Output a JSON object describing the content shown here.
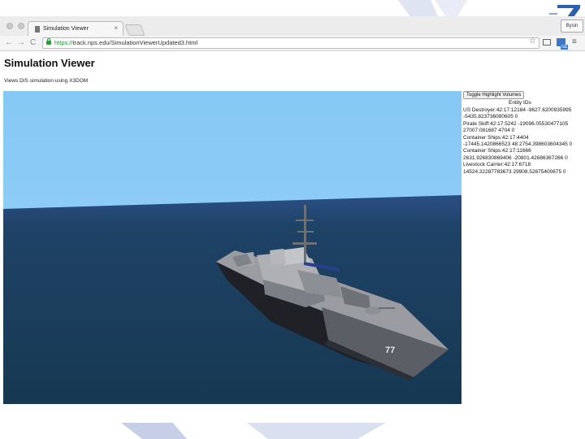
{
  "browser": {
    "tab_title": "Simulation Viewer",
    "tab_close": "×",
    "profile_label": "Bysin",
    "address_scheme": "https://",
    "address_rest": "track.nps.edu/SimulationViewerUpdated3.html",
    "nav": {
      "back": "←",
      "forward": "→",
      "reload": "C"
    },
    "star_icon": "☆",
    "menu_icon": "≡",
    "ext_badge": "GE"
  },
  "page": {
    "title": "Simulation Viewer",
    "subtitle": "Views DIS simulation using X3DOM"
  },
  "scene": {
    "sky_color": "#8ccbf5",
    "sea_color": "#193a54",
    "hull_number": "77"
  },
  "side": {
    "toggle_label": "Toggle Highlight Volumes",
    "ids_title": "Entity IDs",
    "entities": [
      {
        "line1": "US Destroyer:42:17:12184 -9627.6200935995",
        "line2": "-5435.823736080605 0"
      },
      {
        "line1": "Pirate Skiff:42:17:5242 -19096.05530477105",
        "line2": "27007.081687 4704 0"
      },
      {
        "line1": "Container Ships:42:17:4404",
        "line2": "-17445.1420866523 48 2754.398603604345 0"
      },
      {
        "line1": "Container Ships:42:17:11666",
        "line2": "2631.926830869406 -20801.42686367266 0"
      },
      {
        "line1": "Livestock Carrier:42:17:6718",
        "line2": "14524.32287783673 29908.52675400675 0"
      }
    ]
  },
  "colors": {
    "accent": "#2a5fb3",
    "deco": "#c7cfe8"
  }
}
